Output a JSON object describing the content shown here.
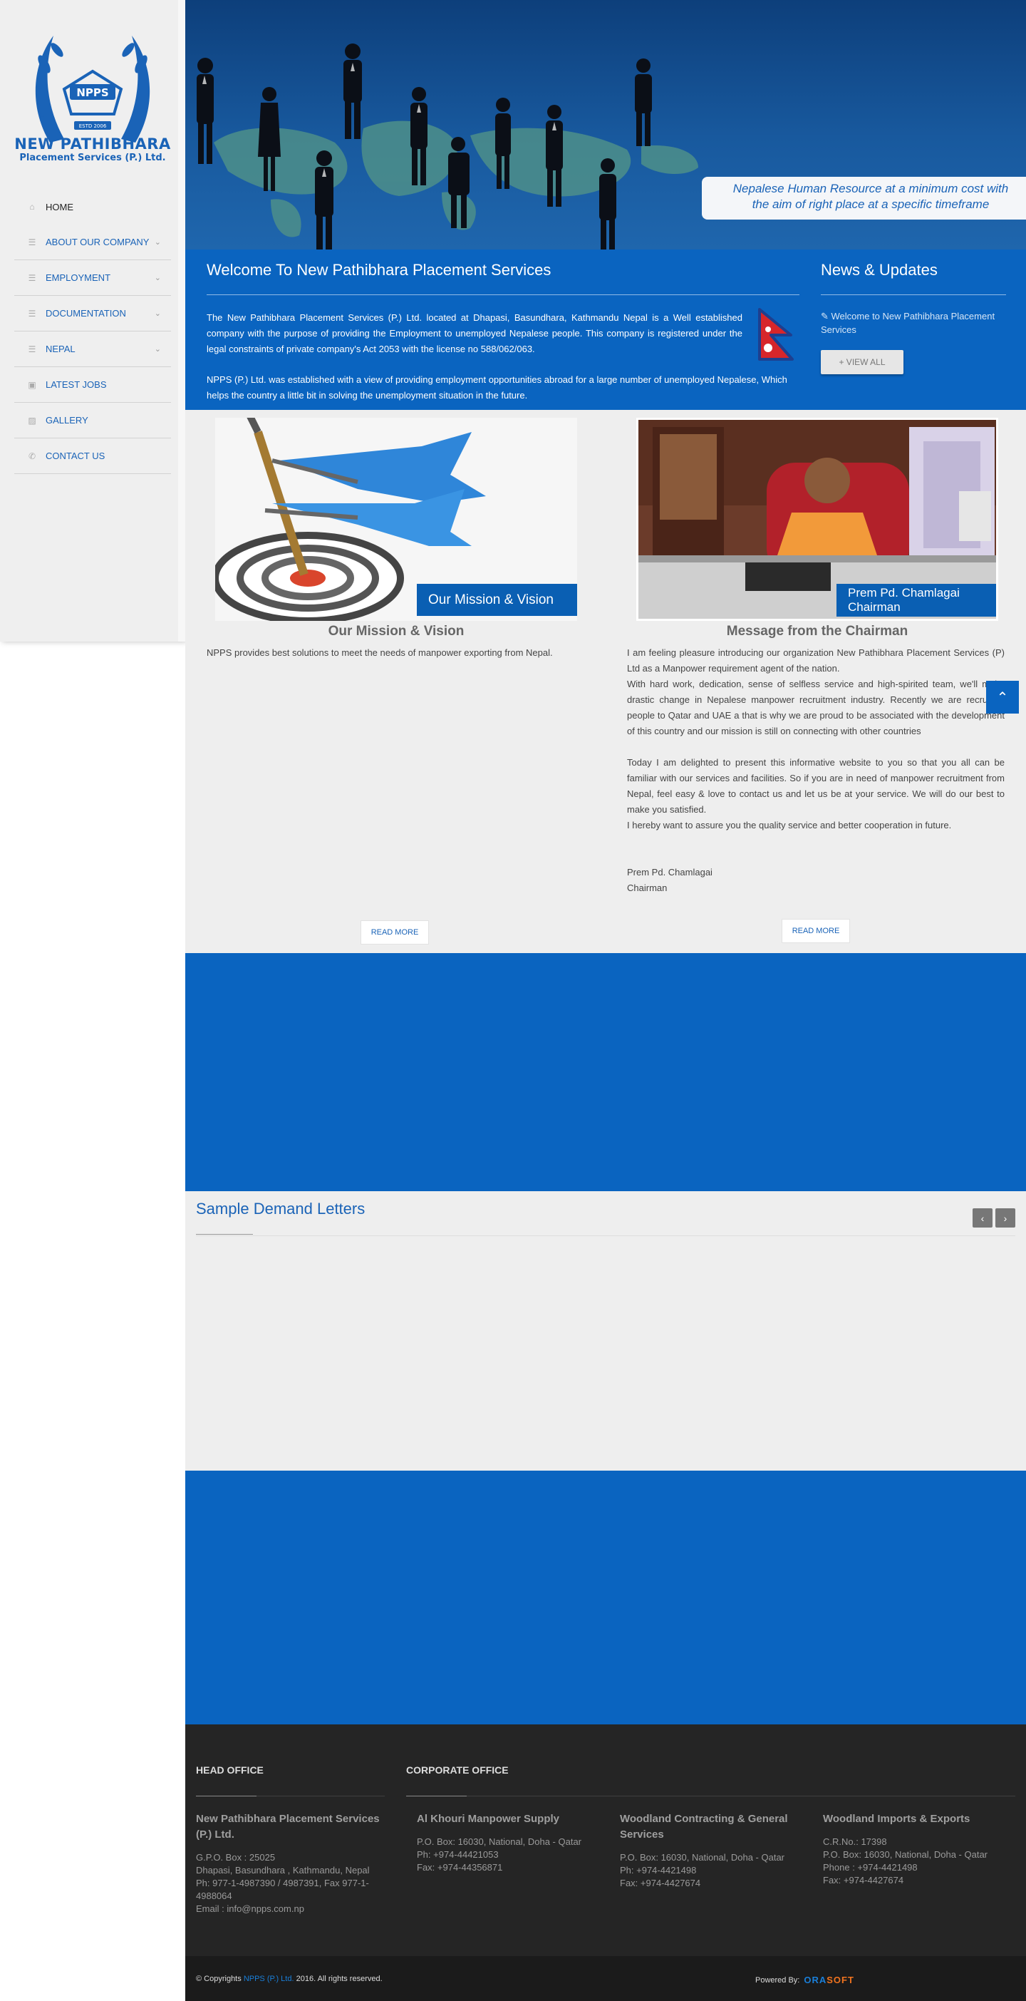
{
  "sidebar": {
    "logo_title": "NEW PATHIBHARA",
    "logo_subtitle": "Placement Services (P.) Ltd.",
    "logo_badge": "NPPS",
    "logo_estd": "ESTD 2006",
    "nav": [
      {
        "label": "HOME",
        "icon": "home-icon",
        "active": true
      },
      {
        "label": "ABOUT OUR COMPANY",
        "icon": "list-icon"
      },
      {
        "label": "EMPLOYMENT",
        "icon": "list-icon"
      },
      {
        "label": "DOCUMENTATION",
        "icon": "list-icon"
      },
      {
        "label": "NEPAL",
        "icon": "list-icon"
      },
      {
        "label": "LATEST JOBS",
        "icon": "briefcase-icon"
      },
      {
        "label": "GALLERY",
        "icon": "image-icon"
      },
      {
        "label": "CONTACT US",
        "icon": "phone-icon"
      }
    ]
  },
  "banner": {
    "tagline_line1": "Nepalese Human Resource at a minimum cost with",
    "tagline_line2": "the aim of right place at a specific timeframe"
  },
  "welcome": {
    "title": "Welcome To New Pathibhara Placement Services",
    "p1": "The New Pathibhara Placement Services (P.) Ltd. located at Dhapasi, Basundhara, Kathmandu Nepal is a Well established company with the purpose of providing the Employment to unemployed Nepalese people. This company is registered under the legal constraints of private company's Act 2053 with the license no 588/062/063.",
    "p2": "NPPS (P.) Ltd. was established with a view of providing employment opportunities abroad for a large number of unemployed Nepalese, Which helps the country a little bit in solving the unemployment situation in the future."
  },
  "news": {
    "title": "News & Updates",
    "item": "Welcome to New Pathibhara Placement Services",
    "view_all": "+ VIEW ALL"
  },
  "mission": {
    "image_caption": "Our Mission & Vision",
    "title": "Our Mission & Vision",
    "text": "NPPS provides best solutions to meet the needs of manpower exporting from Nepal.",
    "read_more": "READ MORE"
  },
  "chairman": {
    "image_caption_line1": "Prem Pd. Chamlagai",
    "image_caption_line2": "Chairman",
    "title": "Message from the Chairman",
    "p1": "I am feeling pleasure introducing our organization New Pathibhara Placement Services (P) Ltd as a Manpower requirement agent of the nation.",
    "p2": "With hard work, dedication, sense of selfless service and high-spirited team, we'll make drastic change in Nepalese manpower recruitment industry. Recently we are recruiting people to Qatar and UAE a that is why we are proud to be associated with the development of this country and our mission is still on connecting with other countries",
    "p3": "Today I am delighted to present this informative website to you so that you all can be familiar with our services and facilities. So if you are in need of manpower recruitment from Nepal, feel easy & love to contact us and let us be at your service. We will do our best to make you satisfied.",
    "p4": "I hereby want to assure you the quality service and better cooperation in future.",
    "sign_name": "Prem Pd. Chamlagai",
    "sign_title": "Chairman",
    "read_more": "READ MORE"
  },
  "demand": {
    "title": "Sample Demand Letters",
    "prev": "‹",
    "next": "›"
  },
  "footer": {
    "head_office_title": "HEAD OFFICE",
    "corporate_title": "CORPORATE OFFICE",
    "head": {
      "name": "New Pathibhara Placement Services (P.) Ltd.",
      "l1": "G.P.O. Box : 25025",
      "l2": "Dhapasi, Basundhara , Kathmandu, Nepal",
      "l3": "Ph: 977-1-4987390 / 4987391, Fax 977-1-4988064",
      "l4": "Email : info@npps.com.np"
    },
    "corp1": {
      "name": "Al Khouri Manpower Supply",
      "l1": "P.O. Box: 16030, National, Doha - Qatar",
      "l2": "Ph: +974-44421053",
      "l3": "Fax: +974-44356871"
    },
    "corp2": {
      "name": "Woodland Contracting & General Services",
      "l1": "P.O. Box: 16030, National, Doha - Qatar",
      "l2": "Ph: +974-4421498",
      "l3": "Fax: +974-4427674"
    },
    "corp3": {
      "name": "Woodland Imports & Exports",
      "l1": "C.R.No.: 17398",
      "l2": "P.O. Box: 16030, National, Doha - Qatar",
      "l3": "Phone : +974-4421498",
      "l4": "Fax: +974-4427674"
    }
  },
  "copyright": {
    "prefix": "© Copyrights",
    "company": "NPPS (P.) Ltd.",
    "suffix": "2016. All rights reserved.",
    "powered": "Powered By:",
    "brand1": "ORA",
    "brand2": "SOFT"
  }
}
